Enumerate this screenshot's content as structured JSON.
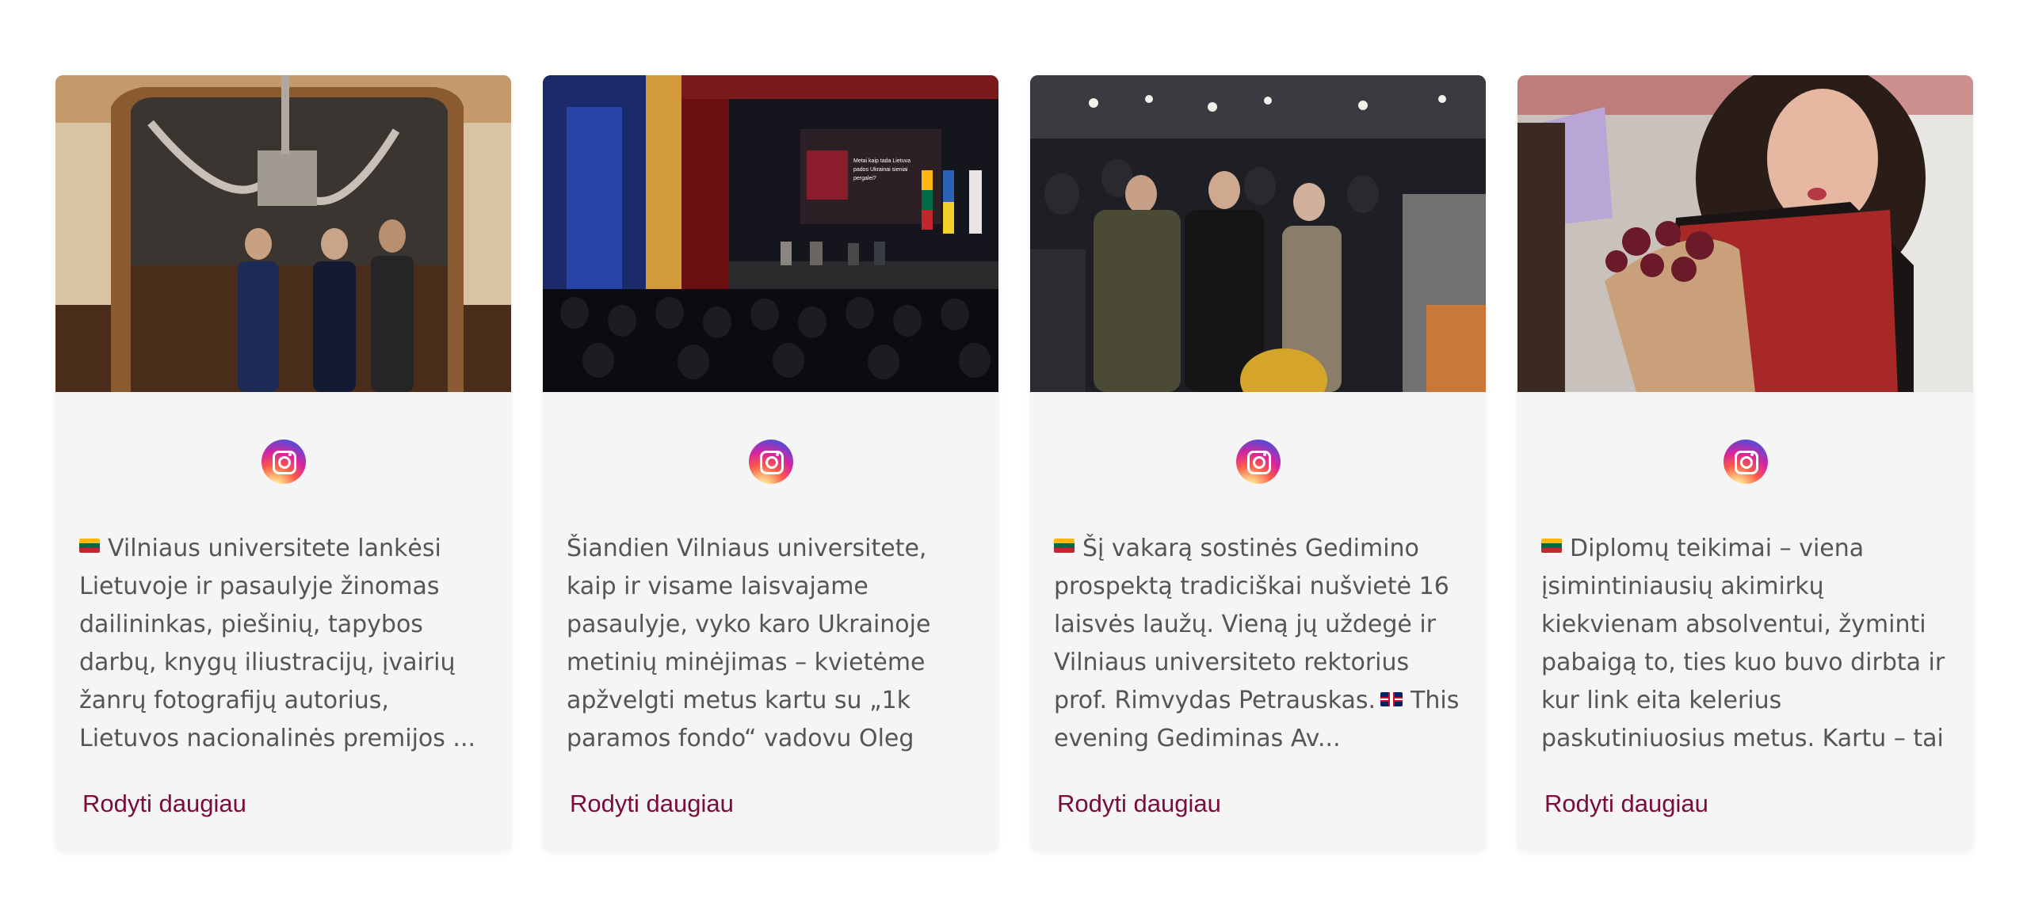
{
  "cards": [
    {
      "icon": "instagram-icon",
      "flag": "lt",
      "caption_text": "Vilniaus universitete lankėsi Lietuvoje ir pasaulyje žinomas dailininkas, piešinių, tapybos darbų, knygų iliustracijų, įvairių žanrų fotografijų autorius, Lietuvos nacionalinės premijos ...",
      "more_label": "Rodyti daugiau"
    },
    {
      "icon": "instagram-icon",
      "flag": "",
      "caption_text": "Šiandien Vilniaus universitete, kaip ir visame laisvajame pasaulyje, vyko karo Ukrainoje metinių minėjimas – kvietėme apžvelgti metus kartu su „1k paramos fondo“ vadovu Oleg Šurajev bei istor...",
      "more_label": "Rodyti daugiau"
    },
    {
      "icon": "instagram-icon",
      "flag": "lt",
      "caption_text": "Šį vakarą sostinės Gedimino prospektą tradiciškai nušvietė 16 laisvės laužų. Vieną jų uždegė ir Vilniaus universiteto rektorius prof. Rimvydas Petrauskas.",
      "caption_text_after_flag": "This evening Gediminas Av...",
      "more_label": "Rodyti daugiau"
    },
    {
      "icon": "instagram-icon",
      "flag": "lt",
      "caption_text": "Diplomų teikimai – viena įsimintiniausių akimirkų kiekvienam absolventui, žyminti pabaigą to, ties kuo buvo dirbta ir kur link eita kelerius paskutiniuosius metus. Kartu – tai jaudinanti...",
      "more_label": "Rodyti daugiau"
    }
  ],
  "photo_screen_text": "Metai kaip tada Lietuvos pados Ukrainai sieniai pergalei?",
  "colors": {
    "card_bg": "#f5f5f5",
    "link": "#7a0b3a",
    "text": "#555555"
  }
}
